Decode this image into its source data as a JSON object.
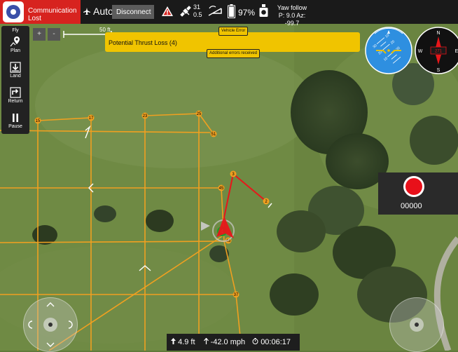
{
  "toolbar": {
    "connection_status": "Communication Lost",
    "flight_mode": "Auto",
    "disconnect_label": "Disconnect",
    "satellites_count": "31",
    "hdop": "0.5",
    "battery_percent": "97%",
    "yaw_mode": "Yaw follow",
    "yaw_values": "P: 9.0   Az: -99.7",
    "colors": {
      "alert": "#d7231f",
      "bar": "#1a1a1a"
    },
    "icons": [
      "app-logo-icon",
      "airplane-mode-icon",
      "warning-icon",
      "satellite-icon",
      "rc-signal-icon",
      "battery-icon",
      "camera-gimbal-icon"
    ]
  },
  "tools": {
    "title": "Fly",
    "items": [
      {
        "label": "Plan",
        "icon": "plan-icon"
      },
      {
        "label": "Land",
        "icon": "land-icon"
      },
      {
        "label": "Return",
        "icon": "return-icon"
      },
      {
        "label": "Pause",
        "icon": "pause-icon"
      }
    ]
  },
  "map": {
    "zoom_in": "+",
    "zoom_out": "-",
    "scale": "50 ft",
    "waypoints": [
      "15",
      "17",
      "23",
      "25",
      "51",
      "45",
      "3",
      "2",
      "4",
      "43",
      "37"
    ],
    "colors": {
      "grid": "#f0a020",
      "active_path": "#e8161a",
      "vehicle": "#e8161a"
    }
  },
  "errors": {
    "vehicle_error_label": "Vehicle Error",
    "message": "Potential Thrust Loss (4)",
    "additional": "Additional errors received",
    "color": "#f0c400"
  },
  "instruments": {
    "attitude_ticks": [
      "30",
      "20",
      "10",
      "10",
      "20",
      "30"
    ],
    "compass": {
      "n": "N",
      "e": "E",
      "w": "W",
      "s": "S",
      "heading": "271"
    }
  },
  "camera": {
    "record_count": "00000",
    "record_color": "#e8101a"
  },
  "telemetry": {
    "altitude": "4.9 ft",
    "speed": "-42.0 mph",
    "flight_time": "00:06:17"
  }
}
